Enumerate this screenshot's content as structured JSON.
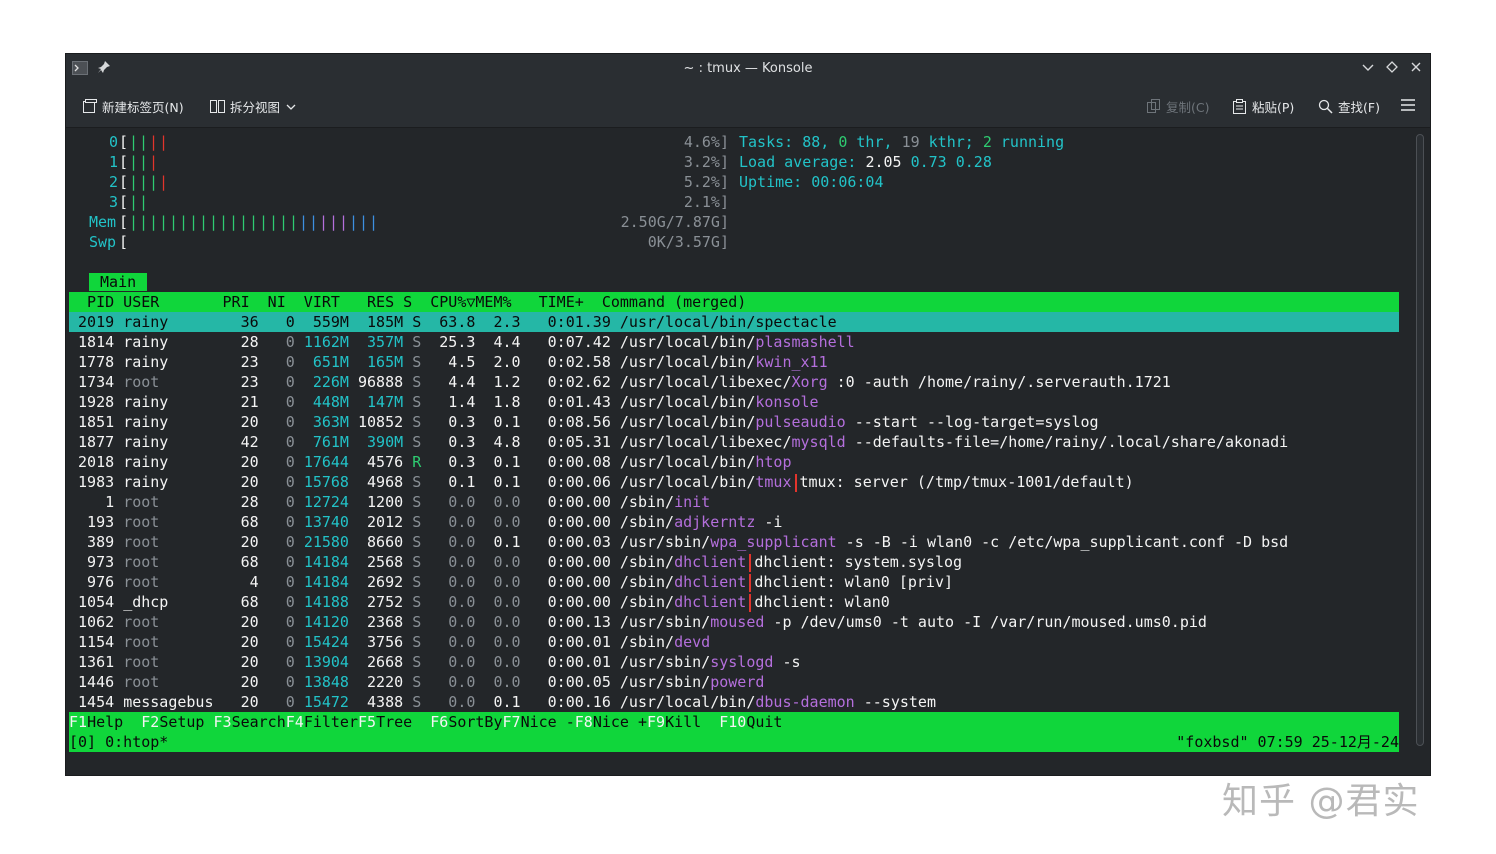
{
  "window": {
    "title": "~ : tmux — Konsole",
    "toolbar": {
      "new_tab": "新建标签页(N)",
      "split_view": "拆分视图",
      "copy": "复制(C)",
      "paste": "粘贴(P)",
      "find": "查找(F)"
    }
  },
  "htop": {
    "cpus": [
      {
        "id": "0",
        "bars": [
          [
            "green",
            "|"
          ],
          [
            "green",
            "|"
          ],
          [
            "red",
            "|"
          ],
          [
            "red",
            "|"
          ]
        ],
        "pct": "4.6%]"
      },
      {
        "id": "1",
        "bars": [
          [
            "green",
            "|"
          ],
          [
            "green",
            "|"
          ],
          [
            "red",
            "|"
          ]
        ],
        "pct": "3.2%]"
      },
      {
        "id": "2",
        "bars": [
          [
            "green",
            "|"
          ],
          [
            "green",
            "|"
          ],
          [
            "green",
            "|"
          ],
          [
            "red",
            "|"
          ]
        ],
        "pct": "5.2%]"
      },
      {
        "id": "3",
        "bars": [
          [
            "green",
            "|"
          ],
          [
            "green",
            "|"
          ]
        ],
        "pct": "2.1%]"
      }
    ],
    "mem": {
      "label": "Mem",
      "value": "2.50G/7.87G]"
    },
    "swp": {
      "label": "Swp",
      "value": "0K/3.57G]"
    },
    "tasks": {
      "label": "Tasks:",
      "procs": "88,",
      "thr": "0",
      "thr_label": "thr,",
      "kthr": "19",
      "kthr_label": "kthr;",
      "running": "2",
      "running_label": "running"
    },
    "load": {
      "label": "Load average:",
      "v1": "2.05",
      "v5": "0.73",
      "v15": "0.28"
    },
    "uptime": {
      "label": "Uptime:",
      "value": "00:06:04"
    },
    "tab": "Main",
    "header": "  PID USER       PRI  NI  VIRT   RES S  CPU%▽MEM%   TIME+  Command (merged)",
    "processes": [
      {
        "pid": "2019",
        "user": "rainy",
        "pri": "36",
        "ni": "0",
        "virt": "559M",
        "res": "185M",
        "s": "S",
        "cpu": "63.8",
        "mem": "2.3",
        "time": "0:01.39",
        "path": "/usr/local/bin/",
        "cmd": "spectacle",
        "args": "",
        "selected": true
      },
      {
        "pid": "1814",
        "user": "rainy",
        "pri": "28",
        "ni": "0",
        "virt": "1162M",
        "res": "357M",
        "s": "S",
        "cpu": "25.3",
        "mem": "4.4",
        "time": "0:07.42",
        "path": "/usr/local/bin/",
        "cmd": "plasmashell",
        "args": ""
      },
      {
        "pid": "1778",
        "user": "rainy",
        "pri": "23",
        "ni": "0",
        "virt": "651M",
        "res": "165M",
        "s": "S",
        "cpu": "4.5",
        "mem": "2.0",
        "time": "0:02.58",
        "path": "/usr/local/bin/",
        "cmd": "kwin_x11",
        "args": ""
      },
      {
        "pid": "1734",
        "user": "root",
        "pri": "23",
        "ni": "0",
        "virt": "226M",
        "res": "96888",
        "s": "S",
        "cpu": "4.4",
        "mem": "1.2",
        "time": "0:02.62",
        "path": "/usr/local/libexec/",
        "cmd": "Xorg",
        "args": " :0 -auth /home/rainy/.serverauth.1721"
      },
      {
        "pid": "1928",
        "user": "rainy",
        "pri": "21",
        "ni": "0",
        "virt": "448M",
        "res": "147M",
        "s": "S",
        "cpu": "1.4",
        "mem": "1.8",
        "time": "0:01.43",
        "path": "/usr/local/bin/",
        "cmd": "konsole",
        "args": ""
      },
      {
        "pid": "1851",
        "user": "rainy",
        "pri": "20",
        "ni": "0",
        "virt": "363M",
        "res": "10852",
        "s": "S",
        "cpu": "0.3",
        "mem": "0.1",
        "time": "0:08.56",
        "path": "/usr/local/bin/",
        "cmd": "pulseaudio",
        "args": " --start --log-target=syslog"
      },
      {
        "pid": "1877",
        "user": "rainy",
        "pri": "42",
        "ni": "0",
        "virt": "761M",
        "res": "390M",
        "s": "S",
        "cpu": "0.3",
        "mem": "4.8",
        "time": "0:05.31",
        "path": "/usr/local/libexec/",
        "cmd": "mysqld",
        "args": " --defaults-file=/home/rainy/.local/share/akonadi"
      },
      {
        "pid": "2018",
        "user": "rainy",
        "pri": "20",
        "ni": "0",
        "virt": "17644",
        "res": "4576",
        "s": "R",
        "cpu": "0.3",
        "mem": "0.1",
        "time": "0:00.08",
        "path": "/usr/local/bin/",
        "cmd": "htop",
        "args": ""
      },
      {
        "pid": "1983",
        "user": "rainy",
        "pri": "20",
        "ni": "0",
        "virt": "15768",
        "res": "4968",
        "s": "S",
        "cpu": "0.1",
        "mem": "0.1",
        "time": "0:00.06",
        "path": "/usr/local/bin/",
        "cmd": "tmux",
        "args": "tmux: server (/tmp/tmux-1001/default)",
        "sep": true
      },
      {
        "pid": "1",
        "user": "root",
        "pri": "28",
        "ni": "0",
        "virt": "12724",
        "res": "1200",
        "s": "S",
        "cpu": "0.0",
        "mem": "0.0",
        "time": "0:00.00",
        "path": "/sbin/",
        "cmd": "init",
        "args": ""
      },
      {
        "pid": "193",
        "user": "root",
        "pri": "68",
        "ni": "0",
        "virt": "13740",
        "res": "2012",
        "s": "S",
        "cpu": "0.0",
        "mem": "0.0",
        "time": "0:00.00",
        "path": "/sbin/",
        "cmd": "adjkerntz",
        "args": " -i"
      },
      {
        "pid": "389",
        "user": "root",
        "pri": "20",
        "ni": "0",
        "virt": "21580",
        "res": "8660",
        "s": "S",
        "cpu": "0.0",
        "mem": "0.1",
        "time": "0:00.03",
        "path": "/usr/sbin/",
        "cmd": "wpa_supplicant",
        "args": " -s -B -i wlan0 -c /etc/wpa_supplicant.conf -D bsd"
      },
      {
        "pid": "973",
        "user": "root",
        "pri": "68",
        "ni": "0",
        "virt": "14184",
        "res": "2568",
        "s": "S",
        "cpu": "0.0",
        "mem": "0.0",
        "time": "0:00.00",
        "path": "/sbin/",
        "cmd": "dhclient",
        "args": "dhclient: system.syslog",
        "sep": true
      },
      {
        "pid": "976",
        "user": "root",
        "pri": "4",
        "ni": "0",
        "virt": "14184",
        "res": "2692",
        "s": "S",
        "cpu": "0.0",
        "mem": "0.0",
        "time": "0:00.00",
        "path": "/sbin/",
        "cmd": "dhclient",
        "args": "dhclient: wlan0 [priv]",
        "sep": true
      },
      {
        "pid": "1054",
        "user": "_dhcp",
        "pri": "68",
        "ni": "0",
        "virt": "14188",
        "res": "2752",
        "s": "S",
        "cpu": "0.0",
        "mem": "0.0",
        "time": "0:00.00",
        "path": "/sbin/",
        "cmd": "dhclient",
        "args": "dhclient: wlan0",
        "sep": true
      },
      {
        "pid": "1062",
        "user": "root",
        "pri": "20",
        "ni": "0",
        "virt": "14120",
        "res": "2368",
        "s": "S",
        "cpu": "0.0",
        "mem": "0.0",
        "time": "0:00.13",
        "path": "/usr/sbin/",
        "cmd": "moused",
        "args": " -p /dev/ums0 -t auto -I /var/run/moused.ums0.pid"
      },
      {
        "pid": "1154",
        "user": "root",
        "pri": "20",
        "ni": "0",
        "virt": "15424",
        "res": "3756",
        "s": "S",
        "cpu": "0.0",
        "mem": "0.0",
        "time": "0:00.01",
        "path": "/sbin/",
        "cmd": "devd",
        "args": ""
      },
      {
        "pid": "1361",
        "user": "root",
        "pri": "20",
        "ni": "0",
        "virt": "13904",
        "res": "2668",
        "s": "S",
        "cpu": "0.0",
        "mem": "0.0",
        "time": "0:00.01",
        "path": "/usr/sbin/",
        "cmd": "syslogd",
        "args": " -s"
      },
      {
        "pid": "1446",
        "user": "root",
        "pri": "20",
        "ni": "0",
        "virt": "13848",
        "res": "2220",
        "s": "S",
        "cpu": "0.0",
        "mem": "0.0",
        "time": "0:00.05",
        "path": "/usr/sbin/",
        "cmd": "powerd",
        "args": ""
      },
      {
        "pid": "1454",
        "user": "messagebus",
        "pri": "20",
        "ni": "0",
        "virt": "15472",
        "res": "4388",
        "s": "S",
        "cpu": "0.0",
        "mem": "0.1",
        "time": "0:00.16",
        "path": "/usr/local/bin/",
        "cmd": "dbus-daemon",
        "args": " --system"
      }
    ],
    "fkeys": [
      {
        "key": "F1",
        "label": "Help  "
      },
      {
        "key": "F2",
        "label": "Setup "
      },
      {
        "key": "F3",
        "label": "Search"
      },
      {
        "key": "F4",
        "label": "Filter"
      },
      {
        "key": "F5",
        "label": "Tree  "
      },
      {
        "key": "F6",
        "label": "SortBy"
      },
      {
        "key": "F7",
        "label": "Nice -"
      },
      {
        "key": "F8",
        "label": "Nice +"
      },
      {
        "key": "F9",
        "label": "Kill  "
      },
      {
        "key": "F10",
        "label": "Quit"
      }
    ]
  },
  "tmux": {
    "left": "[0] 0:htop*",
    "right": "\"foxbsd\" 07:59 25-12月-24"
  },
  "watermark": "知乎 @君实",
  "colors": {
    "header_bg": "#10d63b",
    "selected_bg": "#25b7a6",
    "term_bg": "#232629",
    "cyan": "#22c3c8"
  }
}
